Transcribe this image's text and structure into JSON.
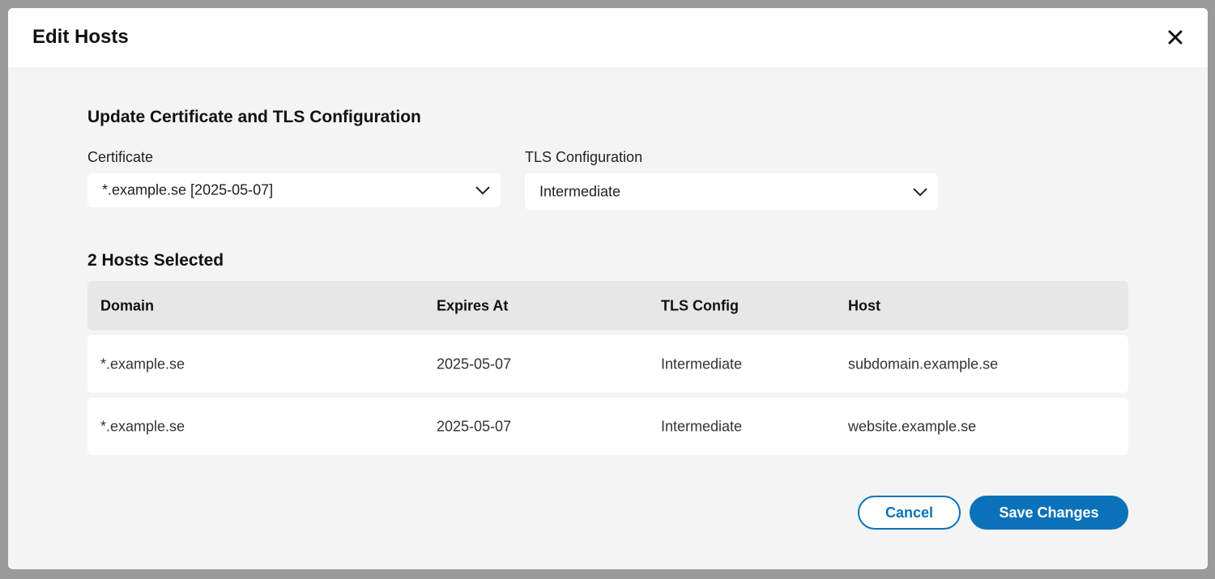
{
  "modal": {
    "title": "Edit Hosts",
    "close_icon": "close-icon"
  },
  "form": {
    "section_title": "Update Certificate and TLS Configuration",
    "certificate": {
      "label": "Certificate",
      "value": "*.example.se [2025-05-07]"
    },
    "tls": {
      "label": "TLS Configuration",
      "value": "Intermediate"
    }
  },
  "hosts": {
    "title": "2 Hosts Selected",
    "columns": [
      "Domain",
      "Expires At",
      "TLS Config",
      "Host"
    ],
    "rows": [
      [
        "*.example.se",
        "2025-05-07",
        "Intermediate",
        "subdomain.example.se"
      ],
      [
        "*.example.se",
        "2025-05-07",
        "Intermediate",
        "website.example.se"
      ]
    ]
  },
  "actions": {
    "cancel_label": "Cancel",
    "save_label": "Save Changes"
  },
  "colors": {
    "accent": "#0b72b9",
    "overlay": "#9a9a9a",
    "panel": "#f4f4f4"
  }
}
